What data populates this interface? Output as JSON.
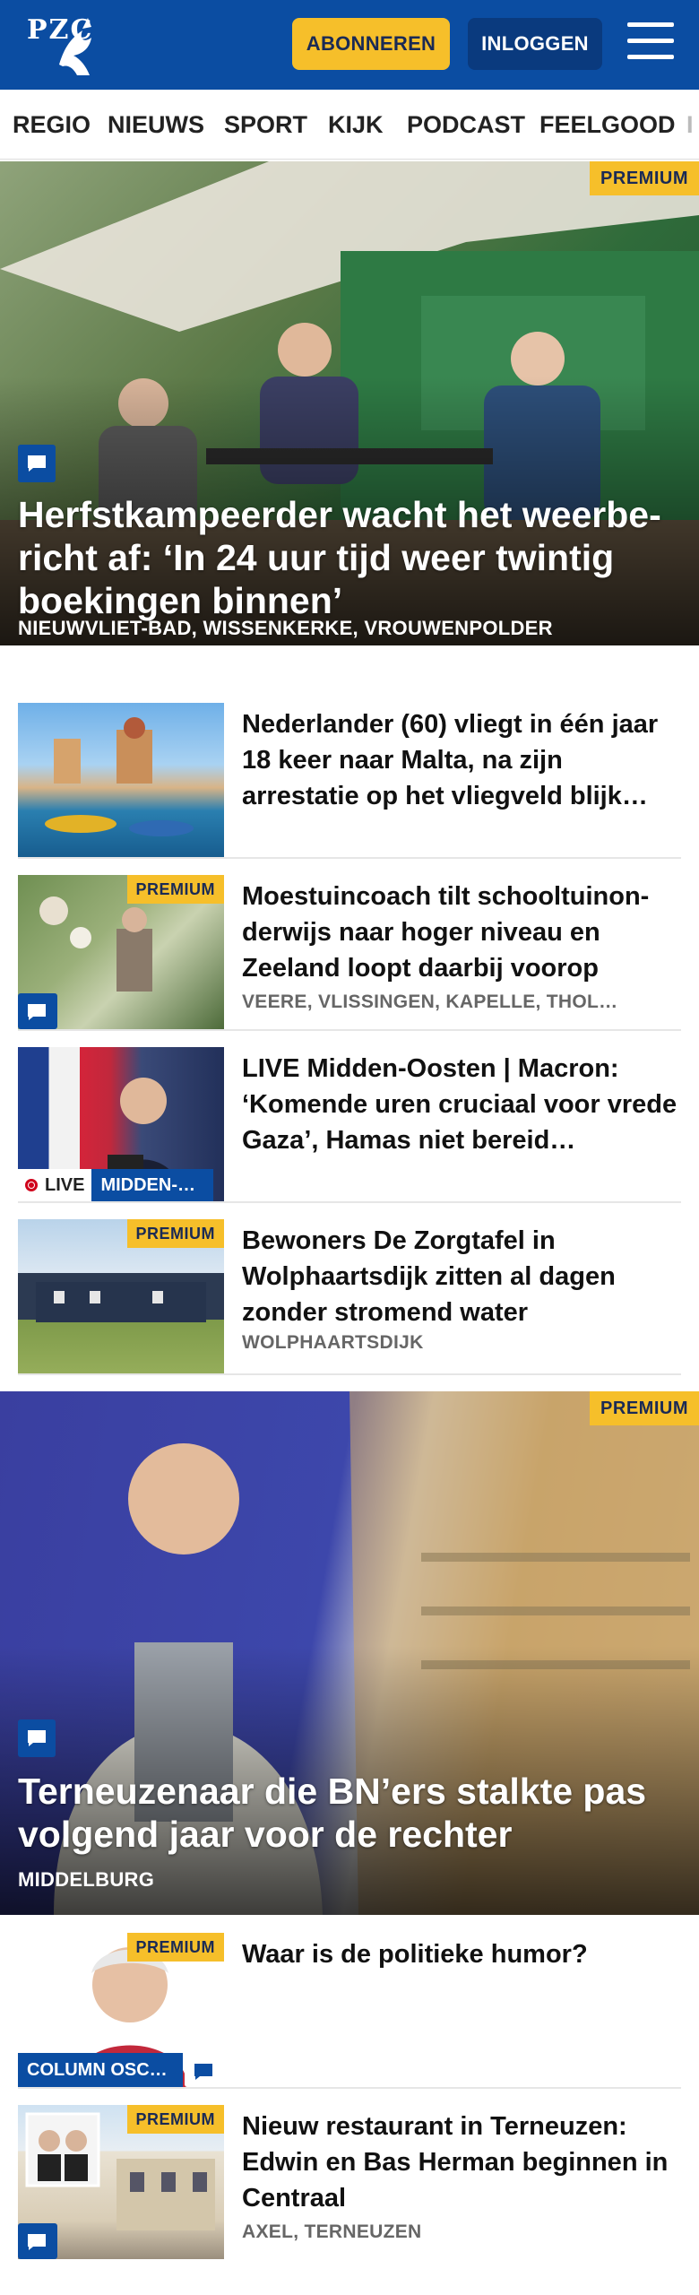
{
  "header": {
    "logo_text": "PZC",
    "subscribe_label": "ABONNEREN",
    "login_label": "INLOGGEN"
  },
  "nav": {
    "items": [
      "REGIO",
      "NIEUWS",
      "SPORT",
      "KIJK",
      "PODCAST",
      "FEELGOOD",
      "I"
    ]
  },
  "colors": {
    "brand_blue": "#0b4da2",
    "accent_yellow": "#f6bf2a",
    "live_red": "#d0021b"
  },
  "hero1": {
    "badge": "PREMIUM",
    "title": "Herfstkampeerder wacht het weerbe­richt af: ‘In 24 uur tijd weer twintig boekingen binnen’",
    "location": "NIEUWVLIET-BAD, WISSENKERKE, VROUWENPOLDER",
    "icon": "comment-icon"
  },
  "articles": [
    {
      "title": "Nederlander (60) vliegt in één jaar 18 keer naar Malta, na zijn arrestatie op het vliegveld blijk…",
      "location": ""
    },
    {
      "badge": "PREMIUM",
      "title": "Moestuincoach tilt schooltuinon­derwijs naar hoger niveau en Zeeland loopt daarbij voorop",
      "location": "VEERE, VLISSINGEN, KAPELLE, THOL…"
    },
    {
      "title": "LIVE Midden-Oosten | Macron: ‘Komende uren cruciaal voor vrede Gaza’, Hamas niet bereid…",
      "live_label": "LIVE",
      "category": "MIDDEN-…"
    },
    {
      "badge": "PREMIUM",
      "title": "Bewoners De Zorgtafel in Wolphaartsdijk zitten al dagen zonder stromend water",
      "location": "WOLPHAARTSDIJK"
    }
  ],
  "hero2": {
    "badge": "PREMIUM",
    "title": "Terneuzenaar die BN’ers stalkte pas volgend jaar voor de rechter",
    "location": "MIDDELBURG",
    "icon": "comment-icon"
  },
  "articles2": [
    {
      "badge": "PREMIUM",
      "title": "Waar is de politieke humor?",
      "category": "COLUMN OSC…"
    },
    {
      "badge": "PREMIUM",
      "title": "Nieuw restaurant in Terneuzen: Edwin en Bas Herman beginnen in Centraal",
      "location": "AXEL, TERNEUZEN"
    }
  ]
}
